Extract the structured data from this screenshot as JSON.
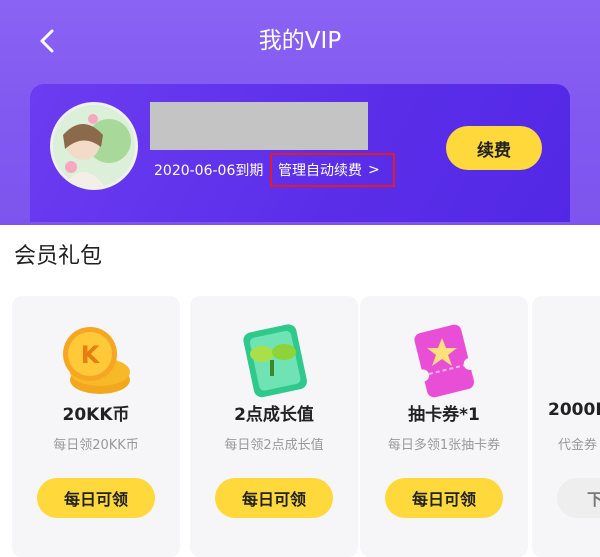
{
  "header": {
    "title": "我的VIP",
    "back_icon": "chevron-left-icon"
  },
  "vip_card": {
    "expire_text": "2020-06-06到期",
    "auto_renew_label": "管理自动续费",
    "auto_renew_chevron": ">",
    "renew_button": "续费"
  },
  "section": {
    "title": "会员礼包"
  },
  "gifts": [
    {
      "icon": "coin-icon",
      "name": "20KK币",
      "desc": "每日领20KK币",
      "button": "每日可领"
    },
    {
      "icon": "growth-card-icon",
      "name": "2点成长值",
      "desc": "每日领2点成长值",
      "button": "每日可领"
    },
    {
      "icon": "ticket-icon",
      "name": "抽卡券*1",
      "desc": "每日多领1张抽卡券",
      "button": "每日可领"
    },
    {
      "icon": "voucher-icon",
      "name": "2000K",
      "desc": "代金券",
      "button": "下"
    }
  ],
  "colors": {
    "header_purple": "#8158f0",
    "card_purple": "#5a2ee9",
    "accent_yellow": "#ffd83b",
    "highlight_red": "#e41b2c"
  }
}
